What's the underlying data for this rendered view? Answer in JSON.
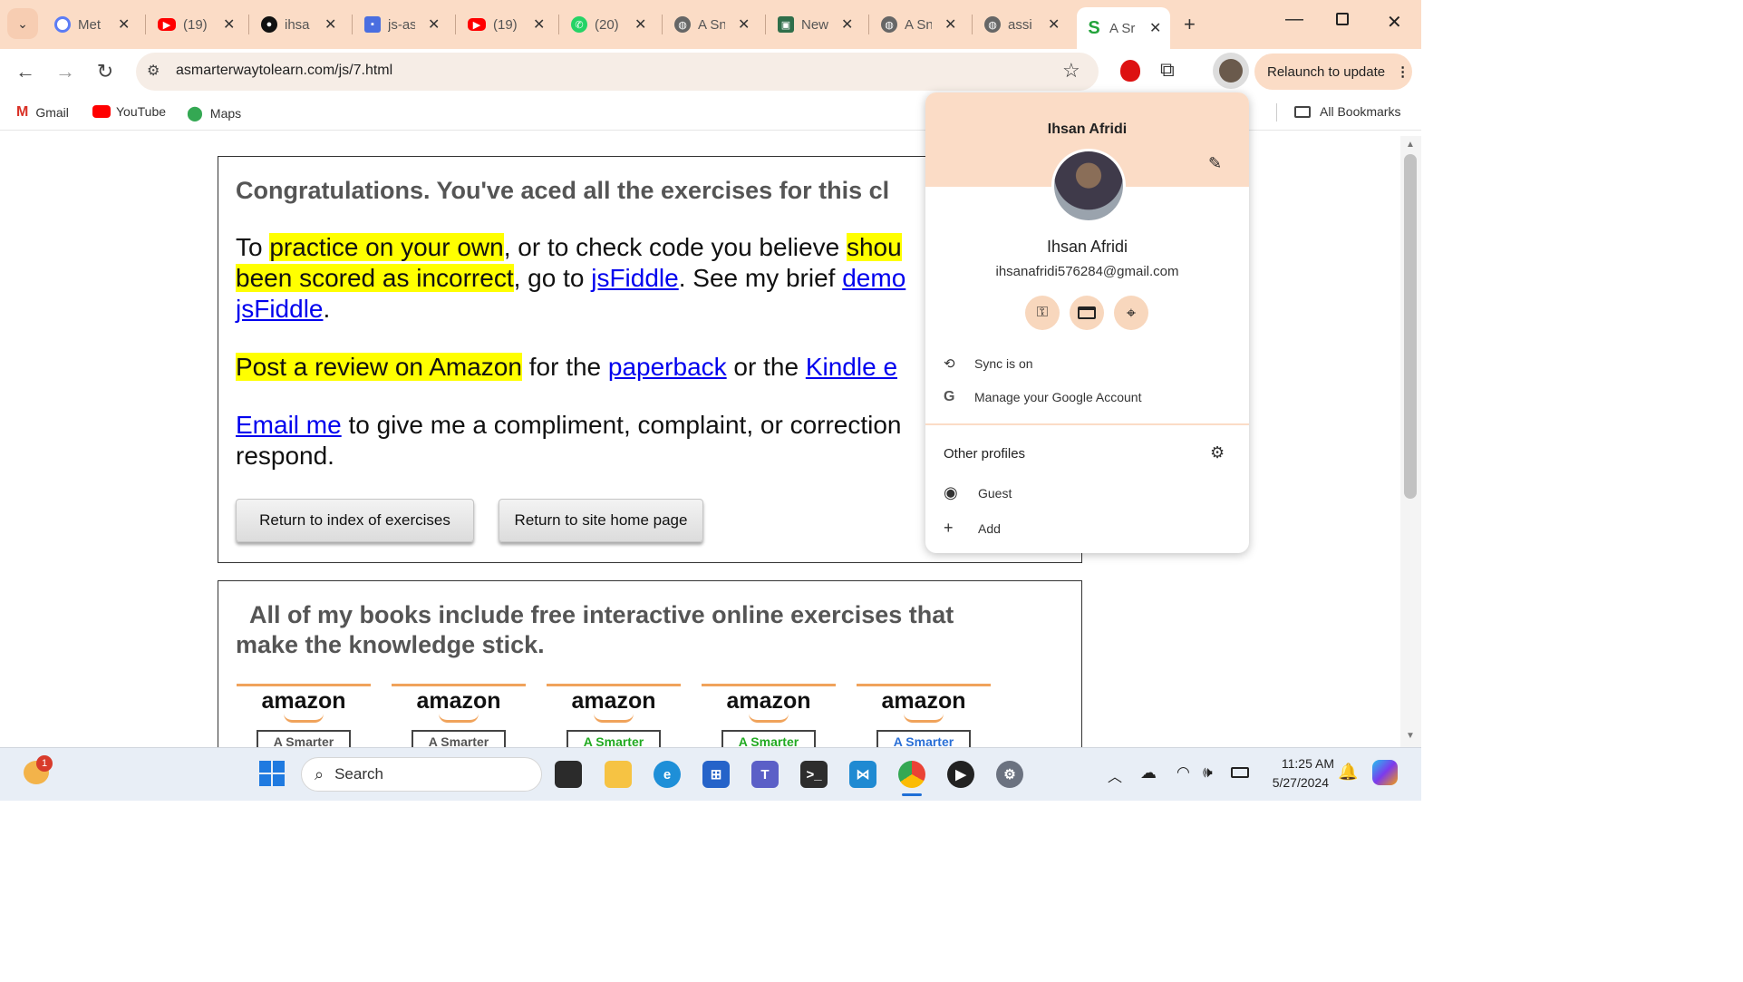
{
  "tabs": [
    {
      "title": "Met",
      "icon": "meta-icon",
      "color": "#3b82f6"
    },
    {
      "title": "(19)",
      "icon": "youtube-icon",
      "color": "#ff0000"
    },
    {
      "title": "ihsa",
      "icon": "github-icon",
      "color": "#111111"
    },
    {
      "title": "js-as",
      "icon": "profile-card-icon",
      "color": "#4a6ee0"
    },
    {
      "title": "(19)",
      "icon": "youtube-icon",
      "color": "#ff0000"
    },
    {
      "title": "(20)",
      "icon": "whatsapp-icon",
      "color": "#25d366"
    },
    {
      "title": "A Sn",
      "icon": "globe-icon",
      "color": "#555555"
    },
    {
      "title": "New",
      "icon": "new-tab-icon",
      "color": "#2f6e4a"
    },
    {
      "title": "A Sn",
      "icon": "globe-icon",
      "color": "#555555"
    },
    {
      "title": "assi",
      "icon": "globe-icon",
      "color": "#555555"
    },
    {
      "title": "A Sr",
      "icon": "s-logo-icon",
      "color": "#22a33a"
    }
  ],
  "toolbar": {
    "url": "asmarterwaytolearn.com/js/7.html",
    "relaunch_label": "Relaunch to update"
  },
  "bookmarks": [
    {
      "label": "Gmail"
    },
    {
      "label": "YouTube"
    },
    {
      "label": "Maps"
    }
  ],
  "all_bookmarks": "All Bookmarks",
  "page": {
    "heading": "Congratulations. You've aced all the exercises for this cl",
    "p1_a": "To ",
    "p1_hl1": "practice on your own",
    "p1_b": ", or to check code you believe ",
    "p1_hl2": "shou",
    "p1_hl3": "been scored as incorrect",
    "p1_c": ", go to ",
    "p1_link1": "jsFiddle",
    "p1_d": ". See my brief ",
    "p1_link2": "demo",
    "p1_link3": "jsFiddle",
    "p1_e": ".",
    "p2_hl": "Post a review on Amazon",
    "p2_a": " for the ",
    "p2_link1": "paperback",
    "p2_b": " or the ",
    "p2_link2": "Kindle e",
    "p3_link": "Email me",
    "p3_a": " to give me a compliment, complaint, or correction",
    "p3_b": "respond.",
    "btn_index": "Return to index of exercises",
    "btn_home": "Return to site home page",
    "books_heading_1": "All of my books include free interactive online exercises that",
    "books_heading_2": "make the knowledge stick.",
    "book_brand": "amazon",
    "book_title": "A Smarter"
  },
  "profile_popup": {
    "name_top": "Ihsan Afridi",
    "name": "Ihsan Afridi",
    "email": "ihsanafridi576284@gmail.com",
    "sync": "Sync is on",
    "manage": "Manage your Google Account",
    "other_profiles": "Other profiles",
    "guest": "Guest",
    "add": "Add"
  },
  "taskbar": {
    "search_placeholder": "Search",
    "time": "11:25 AM",
    "date": "5/27/2024",
    "weather_badge": "1"
  },
  "colors": {
    "tabstrip": "#fbdcc6",
    "highlight": "#ffff00",
    "link": "#0000ee"
  }
}
